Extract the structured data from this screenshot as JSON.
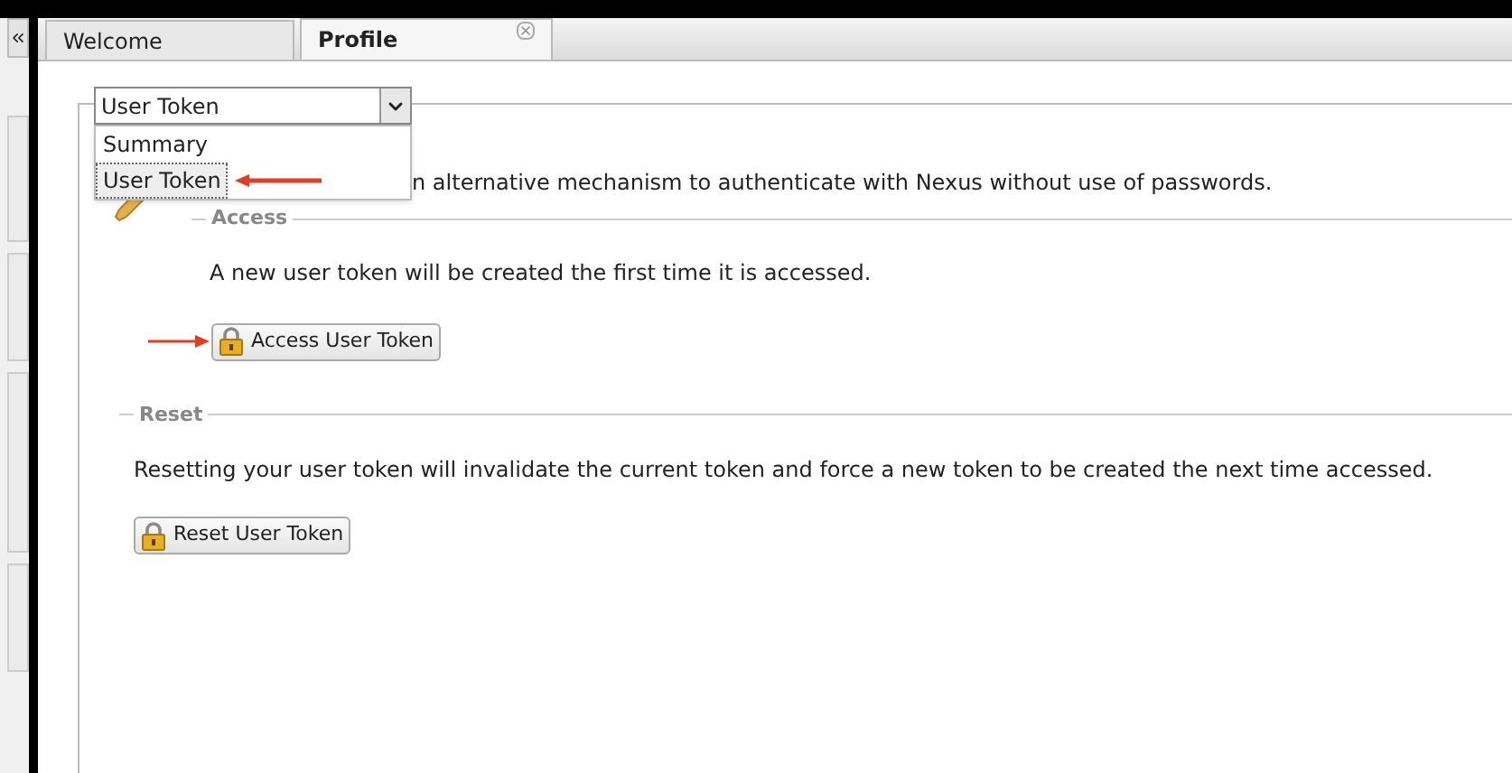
{
  "tabs": [
    {
      "label": "Welcome",
      "selected": false,
      "closable": false
    },
    {
      "label": "Profile",
      "selected": true,
      "closable": true
    }
  ],
  "view_select": {
    "value": "User Token",
    "options": [
      {
        "label": "Summary",
        "selected": false
      },
      {
        "label": "User Token",
        "selected": true
      }
    ]
  },
  "description": "n alternative mechanism to authenticate with Nexus without use of passwords.",
  "access": {
    "legend": "Access",
    "text": "A new user token will be created the first time it is accessed.",
    "button": "Access User Token"
  },
  "reset": {
    "legend": "Reset",
    "text": "Resetting your user token will invalidate the current token and force a new token to be created the next time accessed.",
    "button": "Reset User Token"
  }
}
